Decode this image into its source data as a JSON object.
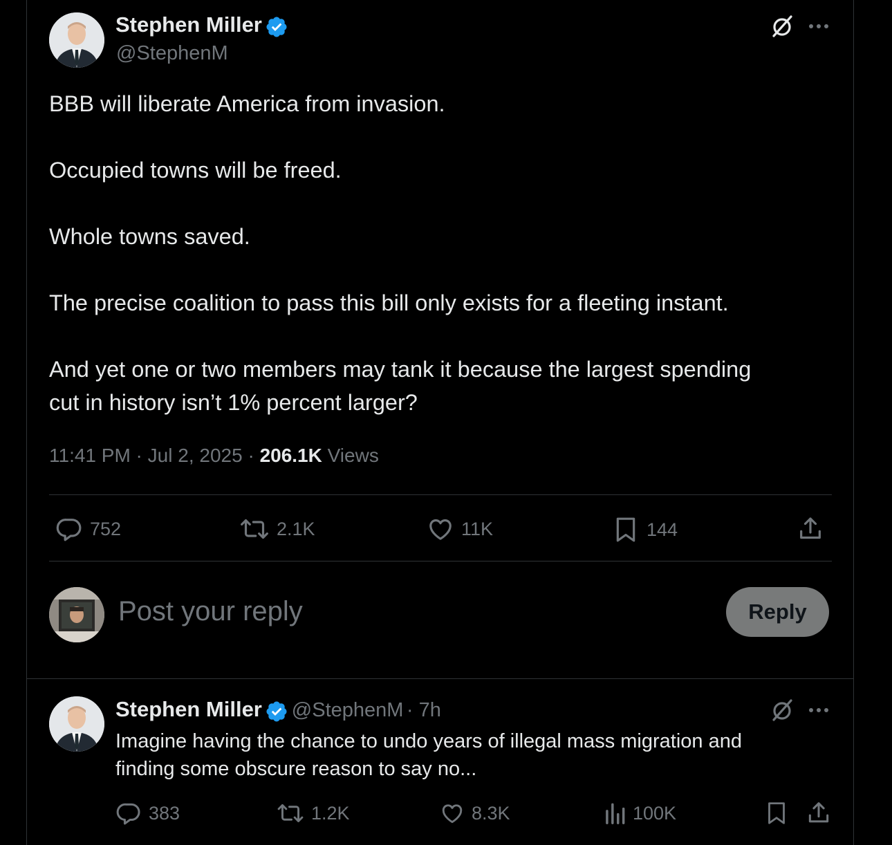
{
  "main_post": {
    "author_name": "Stephen Miller",
    "author_handle": "@StephenM",
    "lines": [
      "BBB will liberate America from invasion.",
      "Occupied towns will be freed.",
      "Whole towns saved.",
      "The precise coalition to pass this bill only exists for a fleeting instant.",
      "And yet one or two members may tank it because the largest spending\ncut in history isn’t 1% percent larger?"
    ],
    "time": "11:41 PM",
    "date": "Jul 2, 2025",
    "views_count": "206.1K",
    "views_label": "Views",
    "stats": {
      "replies": "752",
      "reposts": "2.1K",
      "likes": "11K",
      "bookmarks": "144"
    }
  },
  "composer": {
    "placeholder": "Post your reply",
    "reply_label": "Reply"
  },
  "reply_post": {
    "author_name": "Stephen Miller",
    "author_handle": "@StephenM",
    "age": "· 7h",
    "text": "Imagine having the chance to undo years of illegal mass migration and\nfinding some obscure reason to say no...",
    "stats": {
      "replies": "383",
      "reposts": "1.2K",
      "likes": "8.3K",
      "views": "100K"
    }
  },
  "colors": {
    "background": "#000000",
    "text": "#e7e9ea",
    "secondary": "#71767b",
    "divider": "#2f3336",
    "verified": "#1d9bf0",
    "reply_button": "#787a7a"
  },
  "icons": [
    "verified-badge-icon",
    "grok-icon",
    "more-icon",
    "reply-icon",
    "repost-icon",
    "like-icon",
    "bookmark-icon",
    "share-icon",
    "views-icon"
  ]
}
